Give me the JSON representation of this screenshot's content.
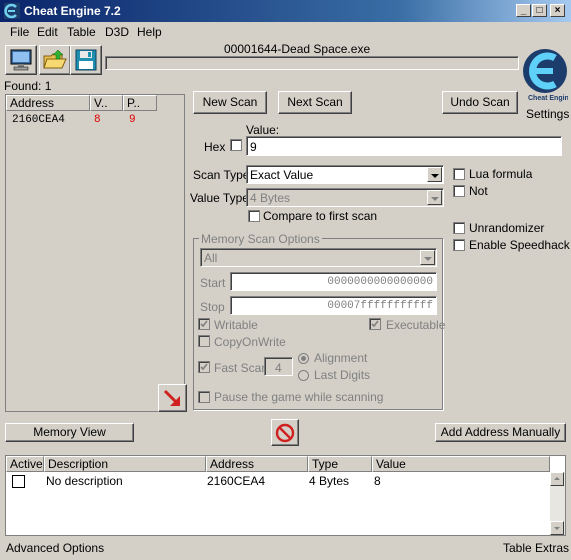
{
  "window": {
    "title": "Cheat Engine 7.2"
  },
  "menu": {
    "file": "File",
    "edit": "Edit",
    "table": "Table",
    "d3d": "D3D",
    "help": "Help"
  },
  "process": {
    "name": "00001644-Dead Space.exe"
  },
  "found": {
    "label": "Found: 1"
  },
  "results": {
    "columns": {
      "address": "Address",
      "value": "V..",
      "previous": "P.."
    },
    "rows": [
      {
        "address": "2160CEA4",
        "value": "8",
        "previous": "9"
      }
    ]
  },
  "buttons": {
    "new_scan": "New Scan",
    "next_scan": "Next Scan",
    "undo_scan": "Undo Scan",
    "memory_view": "Memory View",
    "add_address": "Add Address Manually"
  },
  "logo": {
    "settings_label": "Settings"
  },
  "scan": {
    "value_label": "Value:",
    "hex_label": "Hex",
    "value": "9",
    "scan_type_label": "Scan Type",
    "scan_type": "Exact Value",
    "value_type_label": "Value Type",
    "value_type": "4 Bytes",
    "compare_first": "Compare to first scan",
    "lua_formula": "Lua formula",
    "not": "Not",
    "unrandomizer": "Unrandomizer",
    "enable_speedhack": "Enable Speedhack"
  },
  "memory_options": {
    "title": "Memory Scan Options",
    "region": "All",
    "start_label": "Start",
    "start": "0000000000000000",
    "stop_label": "Stop",
    "stop": "00007fffffffffff",
    "writable": "Writable",
    "executable": "Executable",
    "copy_on_write": "CopyOnWrite",
    "fast_scan": "Fast Scan",
    "fast_scan_value": "4",
    "alignment": "Alignment",
    "last_digits": "Last Digits",
    "pause_game": "Pause the game while scanning"
  },
  "cheat_table": {
    "columns": {
      "active": "Active",
      "description": "Description",
      "address": "Address",
      "type": "Type",
      "value": "Value"
    },
    "rows": [
      {
        "description": "No description",
        "address": "2160CEA4",
        "type": "4 Bytes",
        "value": "8"
      }
    ]
  },
  "status": {
    "advanced": "Advanced Options",
    "extras": "Table Extras"
  },
  "colors": {
    "title_start": "#0a246a",
    "title_end": "#a6caf0",
    "changed_value": "#e00000",
    "face": "#d4d0c8"
  }
}
